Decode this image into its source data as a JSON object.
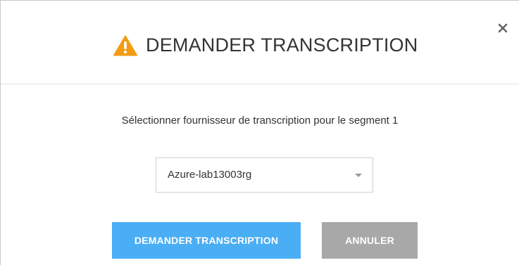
{
  "dialog": {
    "title": "DEMANDER TRANSCRIPTION",
    "title_icon": "warning-triangle-icon",
    "close_icon": "close-icon",
    "prompt": "Sélectionner fournisseur de transcription pour le segment 1",
    "provider_select": {
      "selected": "Azure-lab13003rg"
    },
    "buttons": {
      "request_label": "DEMANDER TRANSCRIPTION",
      "cancel_label": "ANNULER"
    }
  },
  "colors": {
    "warning": "#f39c12",
    "primary": "#4aaef4",
    "secondary": "#a8a8a8",
    "text": "#333333"
  }
}
